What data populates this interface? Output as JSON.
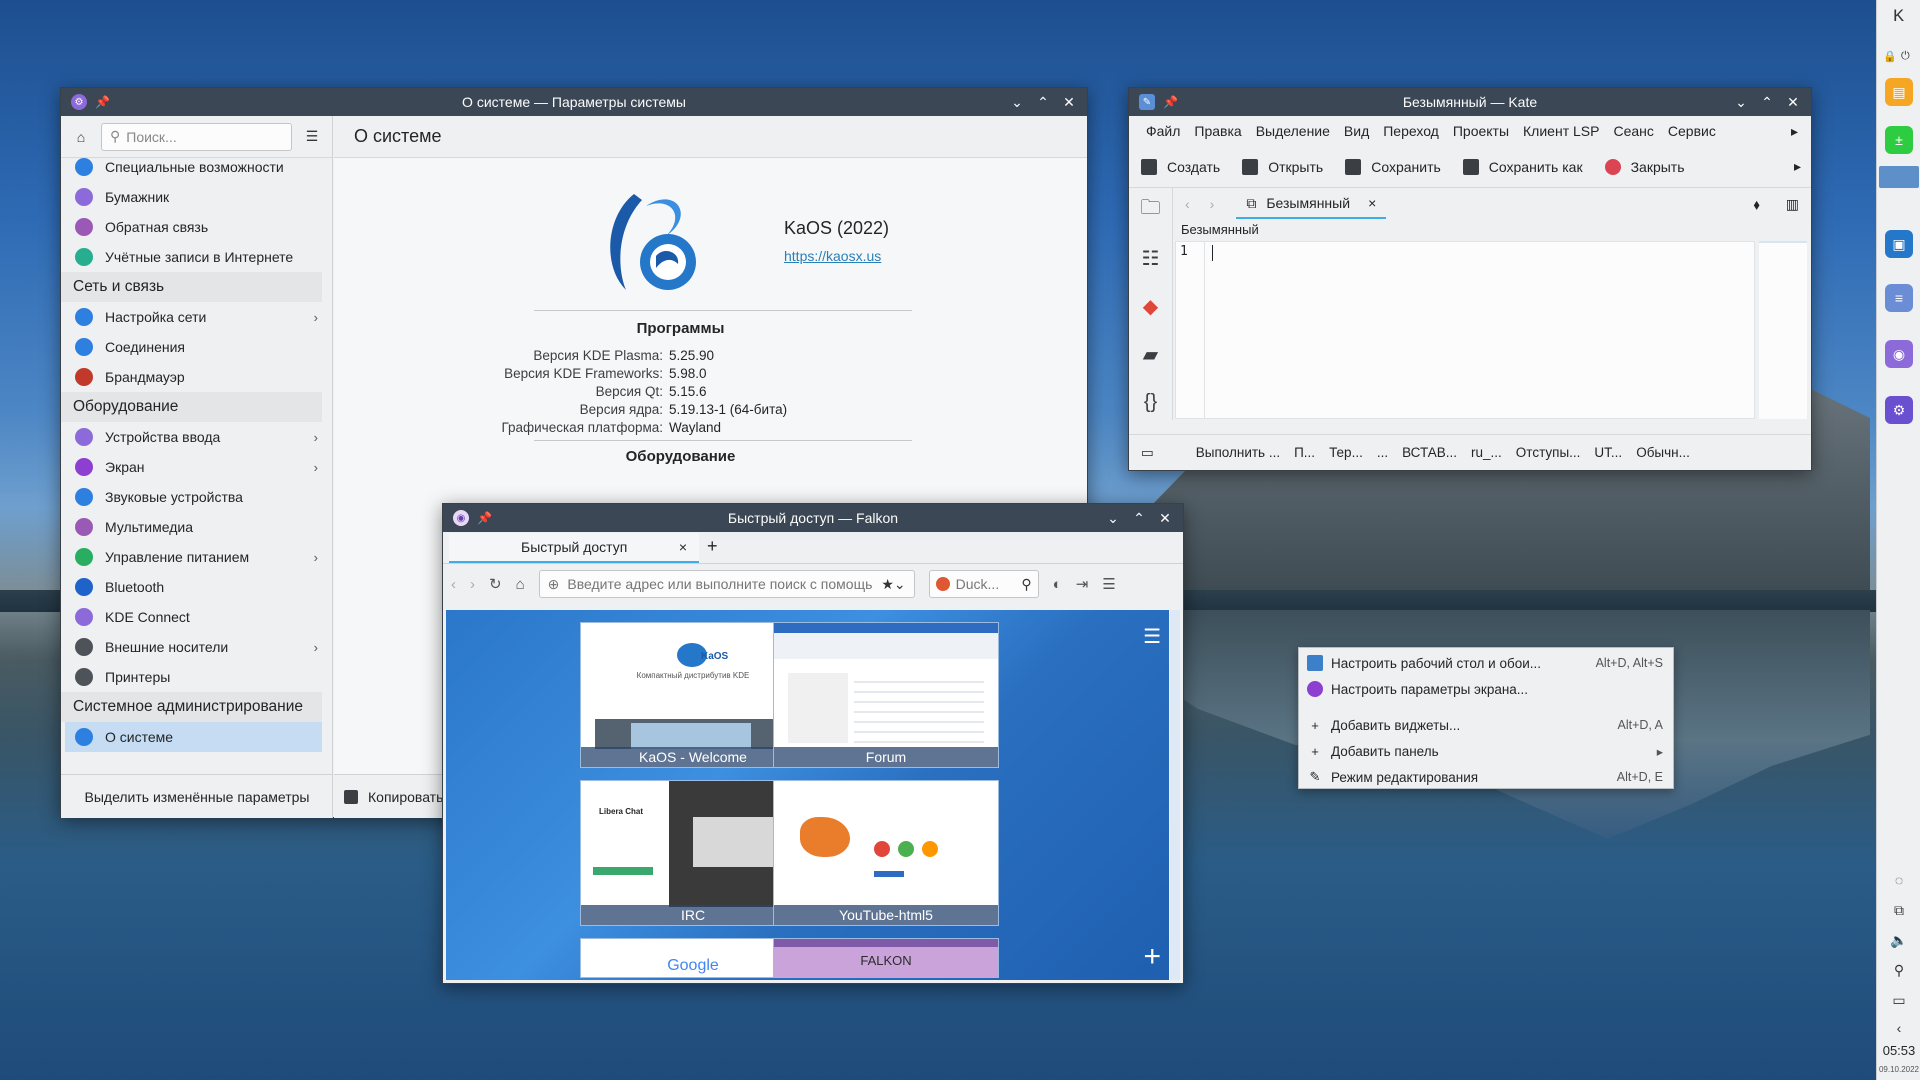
{
  "colors": {
    "accent": "#3daee9",
    "titlebar": "#3b4754",
    "selection": "#c5dcf3"
  },
  "settings": {
    "title": "О системе — Параметры системы",
    "search_placeholder": "Поиск...",
    "sidebar": [
      {
        "type": "item",
        "label": "Специальные возможности",
        "icon": "accessibility-icon",
        "color": "#2d7fe0"
      },
      {
        "type": "item",
        "label": "Бумажник",
        "icon": "wallet-icon",
        "color": "#8c6ad9"
      },
      {
        "type": "item",
        "label": "Обратная связь",
        "icon": "feedback-icon",
        "color": "#9b59b6"
      },
      {
        "type": "item",
        "label": "Учётные записи в Интернете",
        "icon": "globe-icon",
        "color": "#27ae8f"
      },
      {
        "type": "cat",
        "label": "Сеть и связь"
      },
      {
        "type": "item",
        "label": "Настройка сети",
        "icon": "network-icon",
        "color": "#2d7fe0",
        "chev": true
      },
      {
        "type": "item",
        "label": "Соединения",
        "icon": "connections-icon",
        "color": "#2d7fe0"
      },
      {
        "type": "item",
        "label": "Брандмауэр",
        "icon": "firewall-icon",
        "color": "#c0392b"
      },
      {
        "type": "cat",
        "label": "Оборудование"
      },
      {
        "type": "item",
        "label": "Устройства ввода",
        "icon": "input-devices-icon",
        "color": "#8c6ad9",
        "chev": true
      },
      {
        "type": "item",
        "label": "Экран",
        "icon": "display-icon",
        "color": "#8c3fd0",
        "chev": true
      },
      {
        "type": "item",
        "label": "Звуковые устройства",
        "icon": "audio-icon",
        "color": "#2d7fe0"
      },
      {
        "type": "item",
        "label": "Мультимедиа",
        "icon": "multimedia-icon",
        "color": "#9b59b6"
      },
      {
        "type": "item",
        "label": "Управление питанием",
        "icon": "power-icon",
        "color": "#27ae60",
        "chev": true
      },
      {
        "type": "item",
        "label": "Bluetooth",
        "icon": "bluetooth-icon",
        "color": "#1d63c9"
      },
      {
        "type": "item",
        "label": "KDE Connect",
        "icon": "kde-connect-icon",
        "color": "#8c6ad9"
      },
      {
        "type": "item",
        "label": "Внешние носители",
        "icon": "removable-media-icon",
        "color": "#4d5358",
        "chev": true
      },
      {
        "type": "item",
        "label": "Принтеры",
        "icon": "printer-icon",
        "color": "#4d5358"
      },
      {
        "type": "cat",
        "label": "Системное администрирование"
      },
      {
        "type": "item",
        "label": "О системе",
        "icon": "info-icon",
        "color": "#2d7fe0",
        "sel": true
      }
    ],
    "footer_left": "Выделить изменённые параметры",
    "footer_copy": "Копировать",
    "page_title": "О системе",
    "os_name": "KaOS (2022)",
    "os_url": "https://kaosx.us",
    "software_heading": "Программы",
    "software": [
      {
        "k": "Версия KDE Plasma:",
        "v": "5.25.90"
      },
      {
        "k": "Версия KDE Frameworks:",
        "v": "5.98.0"
      },
      {
        "k": "Версия Qt:",
        "v": "5.15.6"
      },
      {
        "k": "Версия ядра:",
        "v": "5.19.13-1 (64-бита)"
      },
      {
        "k": "Графическая платформа:",
        "v": "Wayland"
      }
    ],
    "hardware_heading": "Оборудование"
  },
  "kate": {
    "title": "Безымянный — Kate",
    "menu": [
      "Файл",
      "Правка",
      "Выделение",
      "Вид",
      "Переход",
      "Проекты",
      "Клиент LSP",
      "Сеанс",
      "Сервис"
    ],
    "toolbar": [
      {
        "label": "Создать",
        "icon": "new-file-icon"
      },
      {
        "label": "Открыть",
        "icon": "open-folder-icon"
      },
      {
        "label": "Сохранить",
        "icon": "save-icon"
      },
      {
        "label": "Сохранить как",
        "icon": "save-as-icon"
      },
      {
        "label": "Закрыть",
        "icon": "close-red-icon"
      }
    ],
    "tab": "Безымянный",
    "breadcrumb": "Безымянный",
    "line_number": "1",
    "status": [
      "Выполнить ...",
      "П...",
      "Тер...",
      "...",
      "ВСТАВ...",
      "ru_...",
      "Отступы...",
      "UT...",
      "Обычн..."
    ]
  },
  "falkon": {
    "title": "Быстрый доступ — Falkon",
    "tab": "Быстрый доступ",
    "url_placeholder": "Введите адрес или выполните поиск с помощь...",
    "search_placeholder": "Duck...",
    "dials": [
      {
        "label": "KaOS - Welcome"
      },
      {
        "label": "Forum"
      },
      {
        "label": "IRC"
      },
      {
        "label": "YouTube-html5"
      },
      {
        "label": ""
      },
      {
        "label": ""
      }
    ],
    "thumb_kaos_subtitle": "Компактный дистрибутив KDE",
    "thumb_kaos_logo": "KaOS",
    "thumb_irc_title": "Libera Chat",
    "thumb_google": "Google",
    "thumb_falkon": "FALKON"
  },
  "context_menu": [
    {
      "label": "Настроить рабочий стол и обои...",
      "shortcut": "Alt+D, Alt+S",
      "icon": "desktop-icon"
    },
    {
      "label": "Настроить параметры экрана...",
      "shortcut": "",
      "icon": "display-settings-icon"
    },
    {
      "sep": true
    },
    {
      "label": "Добавить виджеты...",
      "shortcut": "Alt+D, A",
      "icon": "plus-icon"
    },
    {
      "label": "Добавить панель",
      "shortcut": "",
      "icon": "plus-icon",
      "sub": true
    },
    {
      "label": "Режим редактирования",
      "shortcut": "Alt+D, E",
      "icon": "pencil-icon"
    }
  ],
  "panel": {
    "time": "05:53",
    "date": "09.10.2022"
  }
}
